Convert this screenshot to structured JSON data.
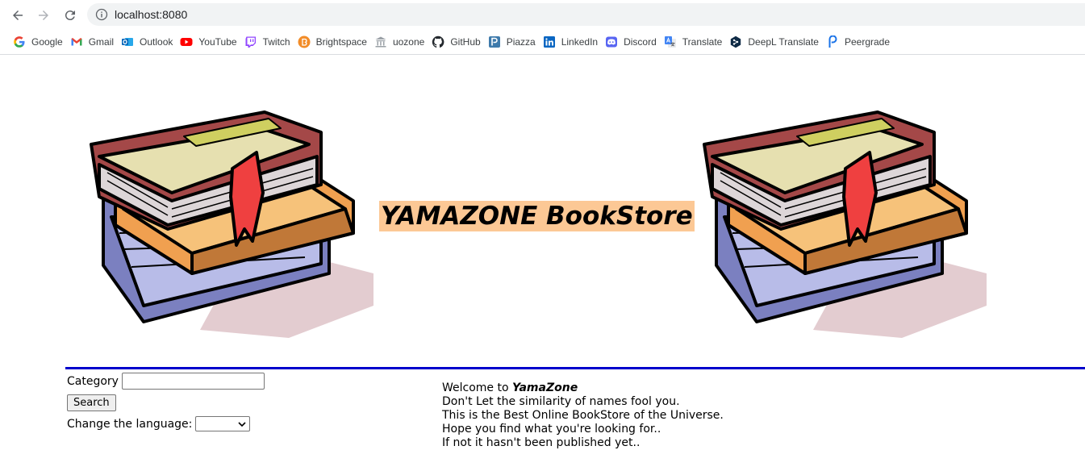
{
  "browser": {
    "url": "localhost:8080",
    "bookmarks": [
      {
        "label": "Google",
        "icon": "google-icon"
      },
      {
        "label": "Gmail",
        "icon": "gmail-icon"
      },
      {
        "label": "Outlook",
        "icon": "outlook-icon"
      },
      {
        "label": "YouTube",
        "icon": "youtube-icon"
      },
      {
        "label": "Twitch",
        "icon": "twitch-icon"
      },
      {
        "label": "Brightspace",
        "icon": "brightspace-icon"
      },
      {
        "label": "uozone",
        "icon": "uozone-icon"
      },
      {
        "label": "GitHub",
        "icon": "github-icon"
      },
      {
        "label": "Piazza",
        "icon": "piazza-icon"
      },
      {
        "label": "LinkedIn",
        "icon": "linkedin-icon"
      },
      {
        "label": "Discord",
        "icon": "discord-icon"
      },
      {
        "label": "Translate",
        "icon": "translate-icon"
      },
      {
        "label": "DeepL Translate",
        "icon": "deepl-icon"
      },
      {
        "label": "Peergrade",
        "icon": "peergrade-icon"
      }
    ]
  },
  "page": {
    "title": "YAMAZONE BookStore",
    "title_bg": "#fcc895",
    "divider_color": "#0000cc",
    "form": {
      "category_label": "Category",
      "category_value": "",
      "search_label": "Search",
      "language_label": "Change the language:",
      "language_value": ""
    },
    "welcome": {
      "line1_prefix": "Welcome to ",
      "line1_brand": "YamaZone",
      "line2": "Don't Let the similarity of names fool you.",
      "line3": "This is the Best Online BookStore of the Universe.",
      "line4": "Hope you find what you're looking for..",
      "line5": "If not it hasn't been published yet.."
    }
  }
}
